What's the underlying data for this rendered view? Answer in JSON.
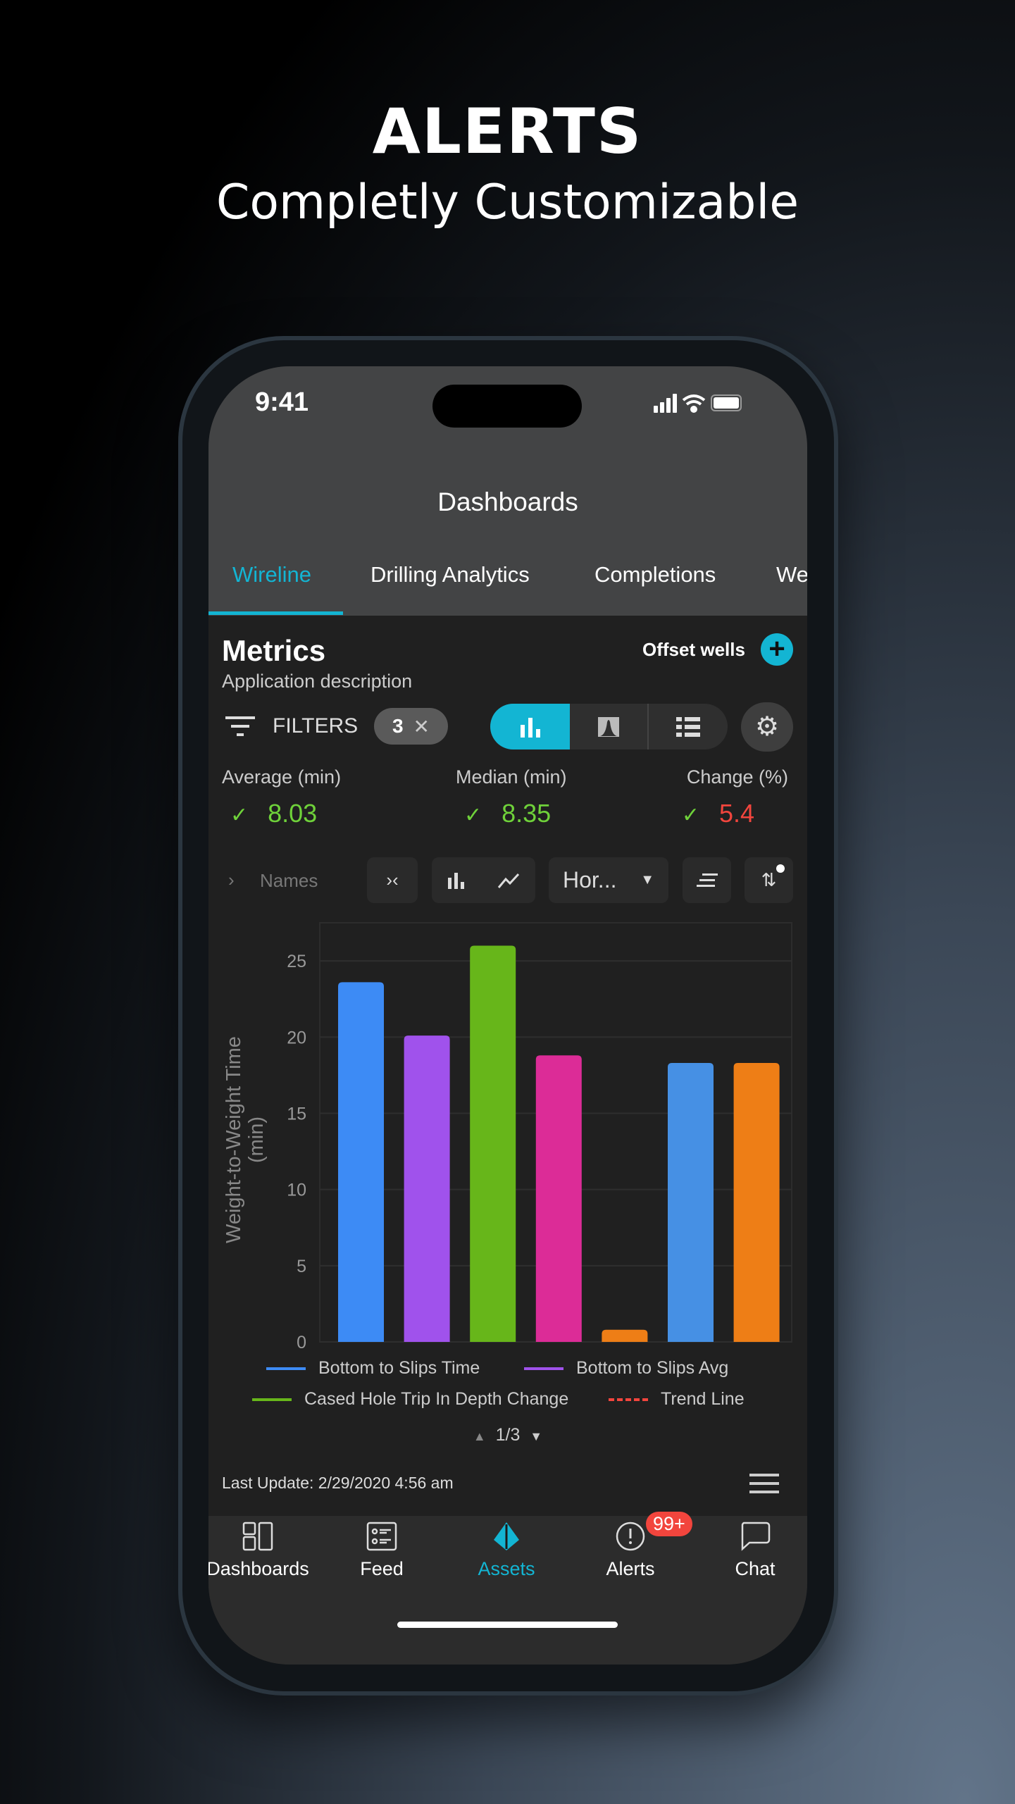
{
  "hero": {
    "title": "ALERTS",
    "subtitle": "Completly Customizable"
  },
  "status": {
    "time": "9:41"
  },
  "header": {
    "title": "Dashboards"
  },
  "tabs": [
    {
      "label": "Wireline",
      "active": true
    },
    {
      "label": "Drilling Analytics"
    },
    {
      "label": "Completions"
    },
    {
      "label": "We"
    }
  ],
  "metrics": {
    "title": "Metrics",
    "description": "Application description",
    "offset_wells": "Offset wells",
    "filters_label": "FILTERS",
    "filter_count": "3"
  },
  "stats": [
    {
      "label": "Average (min)",
      "value": "8.03",
      "color": "#6fd23a"
    },
    {
      "label": "Median (min)",
      "value": "8.35",
      "color": "#6fd23a"
    },
    {
      "label": "Change (%)",
      "value": "5.4",
      "color": "#f2453d"
    }
  ],
  "toolbar": {
    "names": "Names",
    "dropdown": "Hor..."
  },
  "chart_data": {
    "type": "bar",
    "ylabel": "Weight-to-Weight Time (min)",
    "ylim": [
      0,
      27.5
    ],
    "yticks": [
      0,
      5,
      10,
      15,
      20,
      25
    ],
    "grid": true,
    "values": [
      23.6,
      20.1,
      26.0,
      18.8,
      0.8,
      18.3,
      18.3
    ],
    "colors": [
      "#3d8bf5",
      "#a052ec",
      "#67b61a",
      "#dc2c97",
      "#ee7e16",
      "#4690e4",
      "#ee7e16"
    ],
    "legend": [
      {
        "name": "Bottom to Slips Time",
        "color": "#3d8bf5",
        "style": "solid"
      },
      {
        "name": "Bottom to Slips Avg",
        "color": "#a052ec",
        "style": "solid"
      },
      {
        "name": "Cased Hole Trip In Depth Change",
        "color": "#67b61a",
        "style": "solid"
      },
      {
        "name": "Trend Line",
        "color": "#f2453d",
        "style": "dashed"
      }
    ],
    "legend_page": "1/3"
  },
  "footer": {
    "last_update": "Last Update: 2/29/2020 4:56 am"
  },
  "nav": [
    {
      "label": "Dashboards"
    },
    {
      "label": "Feed"
    },
    {
      "label": "Assets",
      "active": true
    },
    {
      "label": "Alerts",
      "badge": "99+"
    },
    {
      "label": "Chat"
    }
  ],
  "colors": {
    "accent": "#13b5d3",
    "header_bg": "#434445",
    "content_bg": "#202020"
  }
}
